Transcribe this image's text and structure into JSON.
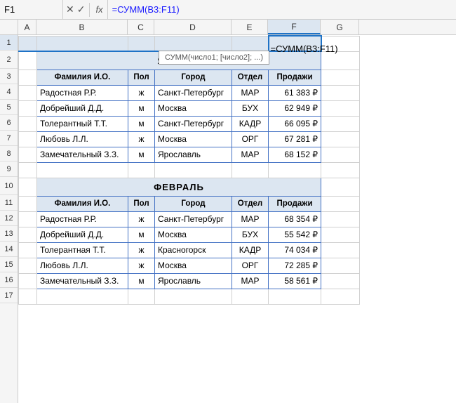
{
  "formulaBar": {
    "cellName": "F1",
    "fxLabel": "fx",
    "formula": "=СУММ(B3:F11)",
    "autocomplete": "СУММ(число1; [число2]; ...)"
  },
  "columns": {
    "headers": [
      "A",
      "B",
      "C",
      "D",
      "E",
      "F",
      "G"
    ]
  },
  "rows": {
    "numbers": [
      "1",
      "2",
      "3",
      "4",
      "5",
      "6",
      "7",
      "8",
      "9",
      "10",
      "11",
      "12",
      "13",
      "14",
      "15",
      "16",
      "17"
    ]
  },
  "formulaOverlay": "=СУММ(B3:F11)",
  "grid": {
    "row1": {
      "f": "=СУММ(B3:F11)"
    },
    "row2": {
      "b_to_f": "ЯНВАРЬ"
    },
    "row3": {
      "b": "Фамилия И.О.",
      "c": "Пол",
      "d": "Город",
      "e": "Отдел",
      "f": "Продажи"
    },
    "row4": {
      "b": "Радостная Р.Р.",
      "c": "ж",
      "d": "Санкт-Петербург",
      "e": "МАР",
      "f": "61 383 ₽"
    },
    "row5": {
      "b": "Добрейший Д.Д.",
      "c": "м",
      "d": "Москва",
      "e": "БУХ",
      "f": "62 949 ₽"
    },
    "row6": {
      "b": "Толерантный Т.Т.",
      "c": "м",
      "d": "Санкт-Петербург",
      "e": "КАДР",
      "f": "66 095 ₽"
    },
    "row7": {
      "b": "Любовь Л.Л.",
      "c": "ж",
      "d": "Москва",
      "e": "ОРГ",
      "f": "67 281 ₽"
    },
    "row8": {
      "b": "Замечательный З.З.",
      "c": "м",
      "d": "Ярославль",
      "e": "МАР",
      "f": "68 152 ₽"
    },
    "row9": {},
    "row10": {
      "b_to_f": "ФЕВРАЛЬ"
    },
    "row11": {
      "b": "Фамилия И.О.",
      "c": "Пол",
      "d": "Город",
      "e": "Отдел",
      "f": "Продажи"
    },
    "row12": {
      "b": "Радостная Р.Р.",
      "c": "ж",
      "d": "Санкт-Петербург",
      "e": "МАР",
      "f": "68 354 ₽"
    },
    "row13": {
      "b": "Добрейший Д.Д.",
      "c": "м",
      "d": "Москва",
      "e": "БУХ",
      "f": "55 542 ₽"
    },
    "row14": {
      "b": "Толерантная Т.Т.",
      "c": "ж",
      "d": "Красногорск",
      "e": "КАДР",
      "f": "74 034 ₽"
    },
    "row15": {
      "b": "Любовь Л.Л.",
      "c": "ж",
      "d": "Москва",
      "e": "ОРГ",
      "f": "72 285 ₽"
    },
    "row16": {
      "b": "Замечательный З.З.",
      "c": "м",
      "d": "Ярославль",
      "e": "МАР",
      "f": "58 561 ₽"
    },
    "row17": {}
  }
}
